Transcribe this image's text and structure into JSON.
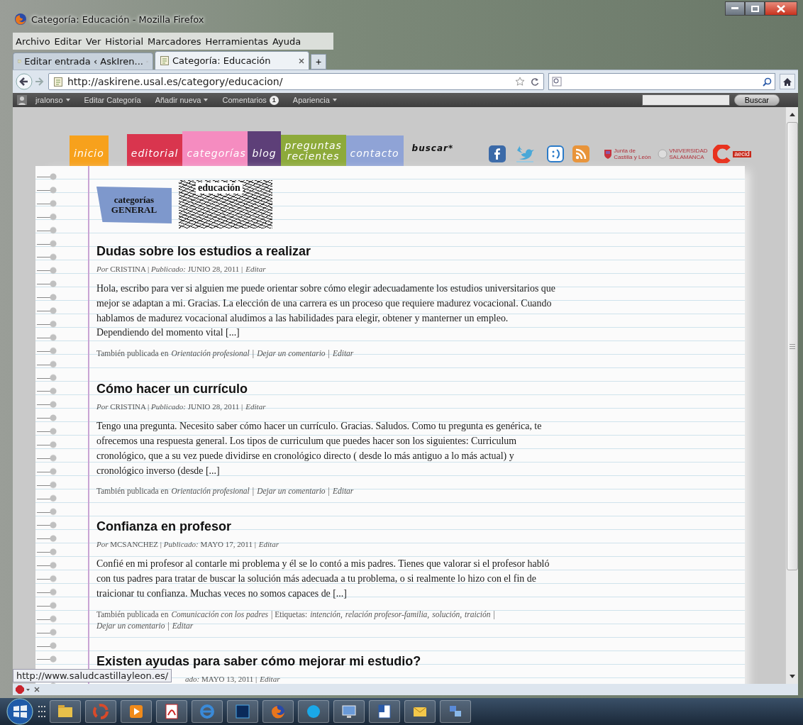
{
  "window": {
    "title": "Categoría: Educación - Mozilla Firefox"
  },
  "menu": [
    "Archivo",
    "Editar",
    "Ver",
    "Historial",
    "Marcadores",
    "Herramientas",
    "Ayuda"
  ],
  "tabs": [
    {
      "label": "Editar entrada ‹ AskIren...",
      "selected": false
    },
    {
      "label": "Categoría: Educación",
      "selected": true
    }
  ],
  "new_tab": "+",
  "address": "http://askirene.usal.es/category/educacion/",
  "admin_bar": {
    "items": [
      {
        "kind": "user",
        "label": "jralonso",
        "menu": true
      },
      {
        "kind": "link",
        "label": "Editar Categoría",
        "menu": false
      },
      {
        "kind": "link",
        "label": "Añadir nueva",
        "menu": true
      },
      {
        "kind": "comments",
        "label": "Comentarios",
        "count": "1",
        "menu": false
      },
      {
        "kind": "link",
        "label": "Apariencia",
        "menu": true
      }
    ],
    "search_button": "Buscar"
  },
  "site_nav": [
    {
      "label": "inicio",
      "color": "#f7a11c"
    },
    {
      "label": "editorial",
      "color": "#d9354e"
    },
    {
      "label": "categorías",
      "color": "#f58cc0"
    },
    {
      "label": "blog",
      "color": "#5d3f78"
    },
    {
      "label": "preguntas recientes",
      "color": "#8daa3a"
    },
    {
      "label": "contacto",
      "color": "#8fa3d6"
    }
  ],
  "search_link": "buscar*",
  "partners": [
    "Junta de Castilla y León",
    "VNIVERSIDAD SALAMANCA",
    "aecid"
  ],
  "category_badge": "categorías GENERAL",
  "category_title": "educación",
  "posts": [
    {
      "title": "Dudas sobre los estudios a realizar",
      "meta": [
        {
          "kind": "text",
          "text": "*Por* CRISTINA | *Publicado:* JUNIO 28, 2011 |"
        },
        {
          "kind": "link",
          "text": "Editar"
        }
      ],
      "body": "Hola, escribo para ver si alguien me puede orientar sobre cómo elegir adecuadamente los estudios universitarios que mejor se adaptan a mi. Gracias. La elección de una carrera es un proceso que requiere madurez vocacional. Cuando hablamos de madurez vocacional aludimos a las habilidades para elegir, obtener y manterner un empleo. Dependiendo del momento vital [...]",
      "footer": [
        {
          "kind": "text",
          "text": "También publicada en"
        },
        {
          "kind": "link",
          "text": "Orientación profesional"
        },
        {
          "kind": "text",
          "text": "|"
        },
        {
          "kind": "link",
          "text": "Dejar un comentario"
        },
        {
          "kind": "text",
          "text": "|"
        },
        {
          "kind": "link",
          "text": "Editar"
        }
      ]
    },
    {
      "title": "Cómo hacer un currículo",
      "meta": [
        {
          "kind": "text",
          "text": "*Por* CRISTINA | *Publicado:* JUNIO 28, 2011 |"
        },
        {
          "kind": "link",
          "text": "Editar"
        }
      ],
      "body": "Tengo una pregunta. Necesito saber cómo hacer un currículo. Gracias. Saludos. Como tu pregunta es genérica, te ofrecemos una respuesta general. Los tipos de curriculum que puedes hacer son los siguientes: Curriculum cronológico, que a su vez puede dividirse en cronológico directo ( desde lo más antiguo a lo más actual) y cronológico inverso (desde [...]",
      "footer": [
        {
          "kind": "text",
          "text": "También publicada en"
        },
        {
          "kind": "link",
          "text": "Orientación profesional"
        },
        {
          "kind": "text",
          "text": "|"
        },
        {
          "kind": "link",
          "text": "Dejar un comentario"
        },
        {
          "kind": "text",
          "text": "|"
        },
        {
          "kind": "link",
          "text": "Editar"
        }
      ]
    },
    {
      "title": "Confianza en profesor",
      "meta": [
        {
          "kind": "text",
          "text": "*Por* MCSANCHEZ | *Publicado:* MAYO 17, 2011 |"
        },
        {
          "kind": "link",
          "text": "Editar"
        }
      ],
      "body": "Confié en mi profesor al contarle mi problema y él se lo contó a mis padres. Tienes que valorar si el profesor habló con tus padres para tratar de buscar la solución más adecuada a tu problema, o si realmente lo hizo con el fin de traicionar tu confianza. Muchas veces no somos capaces de [...]",
      "footer": [
        {
          "kind": "text",
          "text": "También publicada en"
        },
        {
          "kind": "link",
          "text": "Comunicación con los padres"
        },
        {
          "kind": "text",
          "text": "| Etiquetas:"
        },
        {
          "kind": "link",
          "text": "intención,"
        },
        {
          "kind": "link",
          "text": "relación profesor-familia,"
        },
        {
          "kind": "link",
          "text": "solución,"
        },
        {
          "kind": "link",
          "text": "traición"
        },
        {
          "kind": "text",
          "text": "|"
        },
        {
          "kind": "link",
          "text": "Dejar un comentario"
        },
        {
          "kind": "text",
          "text": "|"
        },
        {
          "kind": "link",
          "text": "Editar"
        }
      ]
    },
    {
      "title": "Existen ayudas para saber cómo mejorar mi estudio?",
      "meta": [
        {
          "kind": "text",
          "text": "*ado:* MAYO 13, 2011 |"
        },
        {
          "kind": "link",
          "text": "Editar"
        }
      ]
    }
  ],
  "status_url": "http://www.saludcastillayleon.es/"
}
